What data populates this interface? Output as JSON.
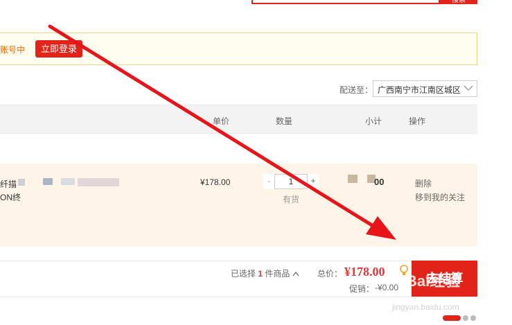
{
  "header": {
    "search_button_label": "搜索"
  },
  "notice": {
    "text": "账号中",
    "login_button": "立即登录"
  },
  "delivery": {
    "label": "配送至：",
    "region": "广西南宁市江南区城区"
  },
  "table_header": {
    "unit_price": "单价",
    "quantity": "数量",
    "subtotal": "小计",
    "operation": "操作"
  },
  "item": {
    "name_line1": "纤描",
    "name_line2": "ON终",
    "price": "¥178.00",
    "qty_minus": "-",
    "quantity": "1",
    "qty_plus": "+",
    "stock": "有货",
    "subtotal": "00",
    "delete": "删除",
    "move_to_favorites": "移到我的关注"
  },
  "footer": {
    "selected_prefix": "已选择",
    "selected_count": "1",
    "selected_suffix": "件商品",
    "chevron": "^",
    "total_label": "总价：",
    "total_value": "¥178.00",
    "promo_label": "促销：",
    "promo_value": "-¥0.00",
    "checkout_label": "去结算"
  },
  "watermark": {
    "brand": "Bai经验",
    "url": "jingyan.baidu.com"
  },
  "colors": {
    "brand_red": "#e2231a",
    "notice_bg": "#fffdee",
    "item_bg": "#fff4e8",
    "arrow": "#e8141a"
  }
}
